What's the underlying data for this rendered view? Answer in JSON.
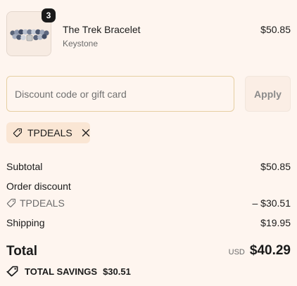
{
  "cart": {
    "items": [
      {
        "quantity": "3",
        "name": "The Trek Bracelet",
        "vendor": "Keystone",
        "price": "$50.85",
        "image_icon": "bracelet-image"
      }
    ]
  },
  "discount": {
    "placeholder": "Discount code or gift card",
    "value": "",
    "apply_label": "Apply",
    "applied_code": "TPDEALS"
  },
  "summary": {
    "subtotal_label": "Subtotal",
    "subtotal_value": "$50.85",
    "order_discount_label": "Order discount",
    "discount_code": "TPDEALS",
    "discount_value": "– $30.51",
    "shipping_label": "Shipping",
    "shipping_value": "$19.95",
    "total_label": "Total",
    "currency": "USD",
    "total_value": "$40.29",
    "savings_label": "TOTAL SAVINGS",
    "savings_value": "$30.51"
  },
  "colors": {
    "background": "#fef5ef",
    "input_border": "#e6cfa2",
    "chip_background": "#fae6d4",
    "badge": "#1a1a1a"
  }
}
